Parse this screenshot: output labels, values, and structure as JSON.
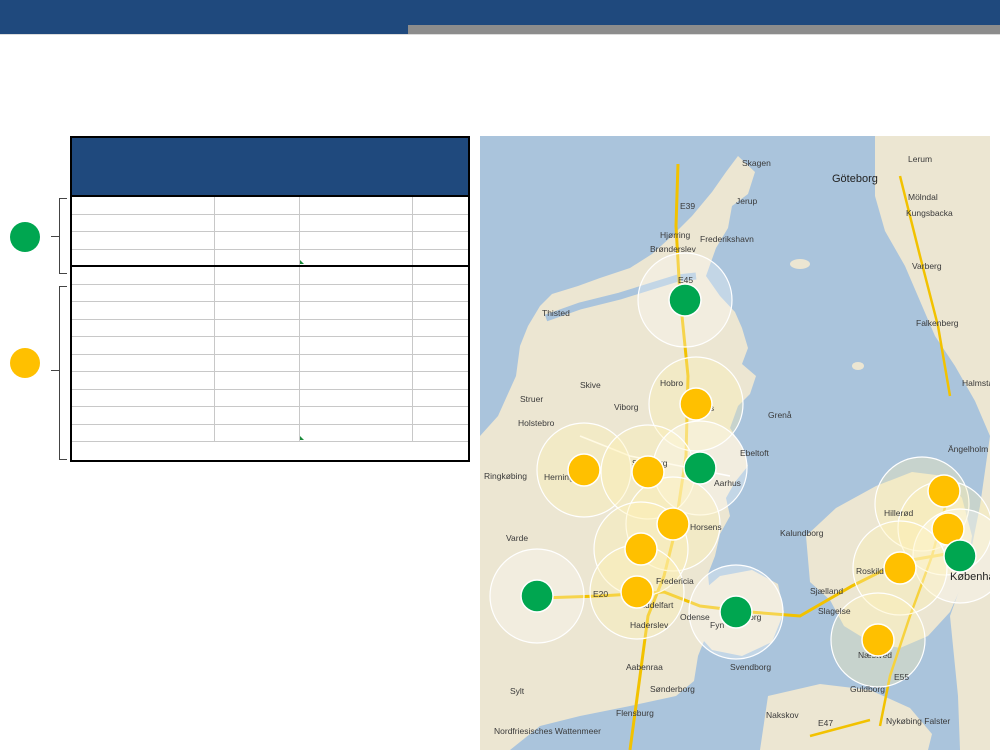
{
  "colors": {
    "header_blue": "#1f497d",
    "accent_gray": "#8c8c8c",
    "status_green": "#00a650",
    "status_yellow": "#ffc000",
    "water": "#aac4dc",
    "land": "#ece6d2"
  },
  "legend": [
    {
      "status": "green",
      "icon": "green-status-dot",
      "rows": 4
    },
    {
      "status": "yellow",
      "icon": "yellow-status-dot",
      "rows": 10
    }
  ],
  "map": {
    "place_labels": [
      "Skagen",
      "Jerup",
      "Hjørring",
      "Frederikshavn",
      "Brønderslev",
      "Thisted",
      "Hobro",
      "Skive",
      "Viborg",
      "Struer",
      "Holstebro",
      "Randers",
      "Grenå",
      "Ebeltoft",
      "Ringkøbing",
      "Herning",
      "Silkeborg",
      "Aarhus",
      "Horsens",
      "Varde",
      "Fredericia",
      "Middelfart",
      "Odense",
      "Nyborg",
      "Kalundborg",
      "Haderslev",
      "Aabenraa",
      "Sønderborg",
      "Svendborg",
      "Flensburg",
      "Sylt",
      "Nordfriesisches Wattenmeer",
      "Nakskov",
      "Guldborg",
      "Nykøbing Falster",
      "Slagelse",
      "Sjælland",
      "Roskilde",
      "København",
      "Hillerød",
      "Næstved",
      "Göteborg",
      "Lerum",
      "Mölndal",
      "Kungsbacka",
      "Varberg",
      "Falkenberg",
      "Halmstad",
      "Ängelholm",
      "Fyn",
      "E45",
      "E39",
      "E20",
      "E55",
      "E47"
    ],
    "station_markers": [
      {
        "status": "green",
        "place": "Aalborg"
      },
      {
        "status": "yellow",
        "place": "Randers"
      },
      {
        "status": "yellow",
        "place": "Herning"
      },
      {
        "status": "yellow",
        "place": "Silkeborg"
      },
      {
        "status": "green",
        "place": "Aarhus"
      },
      {
        "status": "yellow",
        "place": "Horsens"
      },
      {
        "status": "yellow",
        "place": "Vejle"
      },
      {
        "status": "green",
        "place": "Esbjerg"
      },
      {
        "status": "yellow",
        "place": "Kolding"
      },
      {
        "status": "green",
        "place": "Odense"
      },
      {
        "status": "yellow",
        "place": "Helsingør"
      },
      {
        "status": "yellow",
        "place": "Hillerød"
      },
      {
        "status": "green",
        "place": "København"
      },
      {
        "status": "yellow",
        "place": "Roskilde"
      },
      {
        "status": "yellow",
        "place": "Næstved"
      }
    ]
  }
}
